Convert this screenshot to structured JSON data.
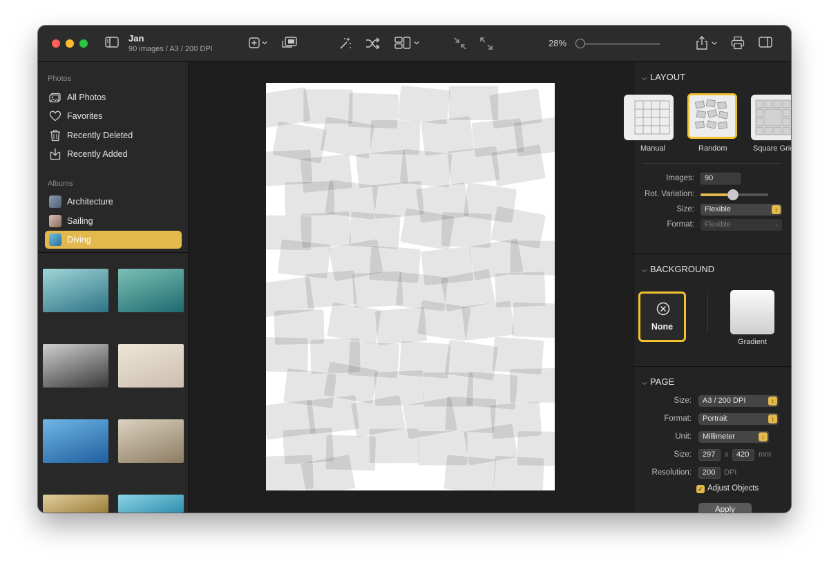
{
  "toolbar": {
    "doc_title": "Jan",
    "doc_subtitle": "90 images / A3 / 200 DPI",
    "zoom_label": "28%",
    "zoom_level": 0.03
  },
  "sidebar": {
    "photos_section": "Photos",
    "photos_items": [
      {
        "label": "All Photos",
        "icon": "photos-icon"
      },
      {
        "label": "Favorites",
        "icon": "heart-icon"
      },
      {
        "label": "Recently Deleted",
        "icon": "trash-icon"
      },
      {
        "label": "Recently Added",
        "icon": "download-tray-icon"
      }
    ],
    "albums_section": "Albums",
    "album_items": [
      {
        "label": "Architecture",
        "color": "#6a7d96"
      },
      {
        "label": "Sailing",
        "color": "#b38f80"
      },
      {
        "label": "Diving",
        "color": "#3d86b8",
        "active": true
      }
    ],
    "thumbnails": [
      {
        "name": "diver-sunrays",
        "colors": [
          "#2f7386",
          "#9fd6d8"
        ]
      },
      {
        "name": "coral-reef",
        "colors": [
          "#1e6a70",
          "#7cc0b5"
        ]
      },
      {
        "name": "brain-coral-bw",
        "colors": [
          "#3a3a3a",
          "#cfcfcf"
        ]
      },
      {
        "name": "sand-seabed",
        "colors": [
          "#cbbfae",
          "#eee5d8"
        ]
      },
      {
        "name": "coral-blue-water",
        "colors": [
          "#1f5f9e",
          "#6fb7e6"
        ]
      },
      {
        "name": "rocky-seabed",
        "colors": [
          "#8c7c62",
          "#dcd2c0"
        ]
      },
      {
        "name": "yellow-coral",
        "colors": [
          "#9c7d3a",
          "#e2cf9e"
        ]
      },
      {
        "name": "shallow-water",
        "colors": [
          "#2e8fae",
          "#8cd4e6"
        ]
      }
    ]
  },
  "inspector": {
    "layout": {
      "heading": "LAYOUT",
      "options": [
        "Manual",
        "Random",
        "Square Grid"
      ],
      "selected": "Random",
      "images_label": "Images:",
      "images_value": "90",
      "rotation_label": "Rot. Variation:",
      "rotation_level": 0.48,
      "size_label": "Size:",
      "size_value": "Flexible",
      "format_label": "Format:",
      "format_value": "Flexible"
    },
    "background": {
      "heading": "BACKGROUND",
      "none_label": "None",
      "gradient_label": "Gradient"
    },
    "page": {
      "heading": "PAGE",
      "size_label": "Size:",
      "size_value": "A3 / 200 DPI",
      "format_label": "Format:",
      "format_value": "Portrait",
      "unit_label": "Unit:",
      "unit_value": "Millimeter",
      "dims_label": "Size:",
      "width_value": "297",
      "x_label": "x",
      "height_value": "420",
      "dims_unit": "mm",
      "resolution_label": "Resolution:",
      "resolution_value": "200",
      "resolution_unit": "DPI",
      "adjust_label": "Adjust Objects",
      "adjust_checked": true,
      "apply_label": "Apply"
    }
  },
  "colors": {
    "accent": "#e3b94d",
    "selection_border": "#f2c230",
    "tile": "#6cb1c0",
    "diver_dark": "#1b2730"
  }
}
